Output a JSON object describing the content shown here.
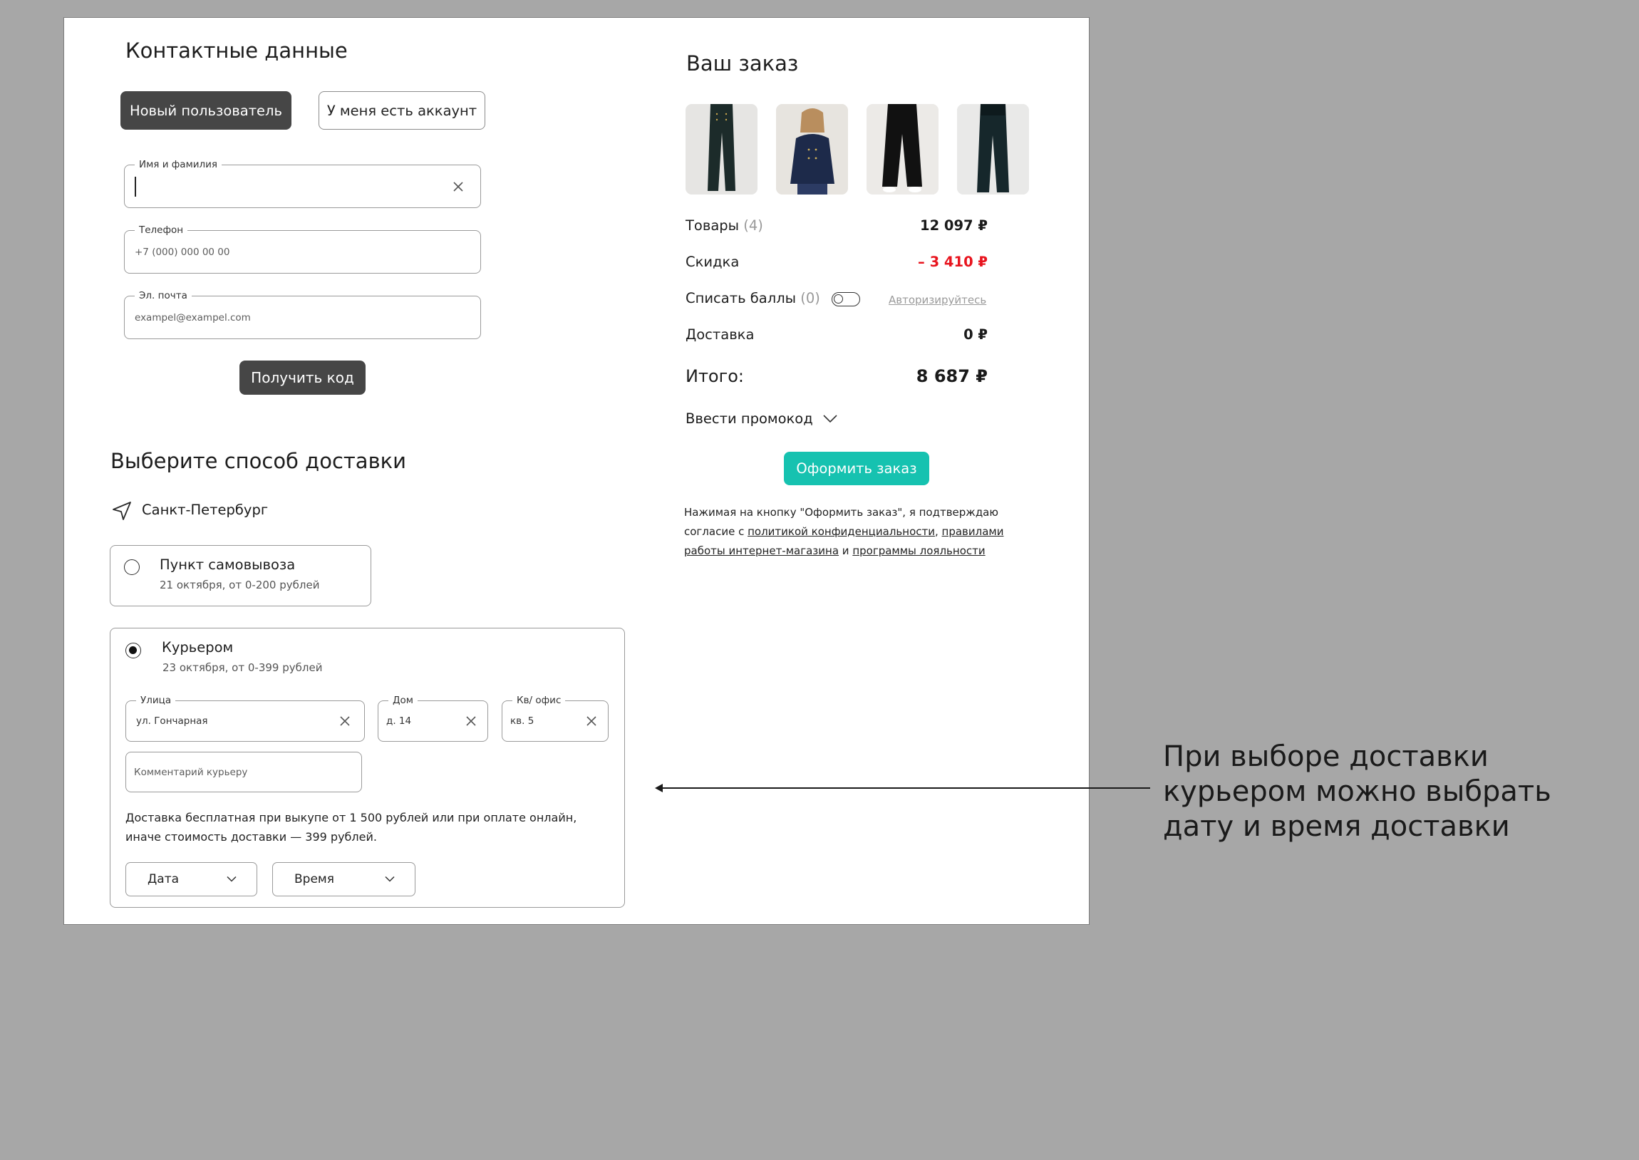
{
  "contact": {
    "title": "Контактные данные",
    "new_user_label": "Новый пользователь",
    "have_account_label": "У меня есть аккаунт",
    "name_field": {
      "label": "Имя и фамилия",
      "value": ""
    },
    "phone_field": {
      "label": "Телефон",
      "placeholder": "+7 (000) 000 00 00"
    },
    "email_field": {
      "label": "Эл. почта",
      "placeholder": "exampel@exampel.com"
    },
    "get_code_label": "Получить код"
  },
  "delivery": {
    "title": "Выберите способ доставки",
    "city": "Санкт-Петербург",
    "options": [
      {
        "title": "Пункт самовывоза",
        "subtitle": "21 октября, от 0-200 рублей",
        "selected": false
      },
      {
        "title": "Курьером",
        "subtitle": "23 октября, от 0-399 рублей",
        "selected": true
      }
    ],
    "street_field": {
      "label": "Улица",
      "value": "ул. Гончарная"
    },
    "house_field": {
      "label": "Дом",
      "value": "д. 14"
    },
    "apt_field": {
      "label": "Кв/ офис",
      "value": "кв. 5"
    },
    "comment_field": {
      "placeholder": "Комментарий курьеру"
    },
    "note_line1": "Доставка бесплатная при выкупе от 1 500 рублей или при оплате онлайн,",
    "note_line2": "иначе стоимость доставки — 399 рублей.",
    "date_select": "Дата",
    "time_select": "Время"
  },
  "order": {
    "title": "Ваш заказ",
    "thumbnails": [
      "product-1",
      "product-2",
      "product-3",
      "product-4"
    ],
    "items_label": "Товары",
    "items_count": "(4)",
    "items_value": "12 097 ₽",
    "discount_label": "Скидка",
    "discount_value": "– 3 410 ₽",
    "points_label": "Списать баллы",
    "points_count": "(0)",
    "authorize_link": "Авторизируйтесь",
    "delivery_label": "Доставка",
    "delivery_value": "0 ₽",
    "total_label": "Итого:",
    "total_value": "8 687 ₽",
    "promo_label": "Ввести промокод",
    "submit_label": "Оформить заказ",
    "legal": {
      "line1": "Нажимая на кнопку \"Оформить заказ\", я подтверждаю",
      "line2_prefix": "согласие с ",
      "privacy_link": "политикой конфиденциальности",
      "comma": ", ",
      "rules_link_part1": "правилами",
      "rules_link_part2": "работы интернет-магазина",
      "and": " и ",
      "loyalty_link": "программы лояльности"
    }
  },
  "annotation": {
    "line1": "При выборе доставки",
    "line2": "курьером можно выбрать",
    "line3": "дату и время доставки"
  },
  "colors": {
    "accent": "#16c2b0",
    "discount": "#e8141e",
    "dark_button": "#464646",
    "page_bg": "#a7a7a7"
  }
}
